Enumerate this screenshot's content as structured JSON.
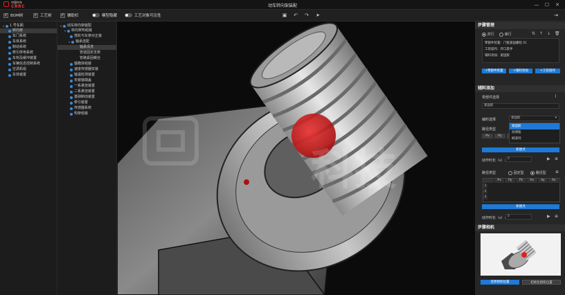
{
  "window": {
    "title": "动车转向架装配",
    "logo_text": "中国中车",
    "logo_brand": "CRRC"
  },
  "toolbar": {
    "bom_tree": "BOM树",
    "process_tree": "工艺树",
    "assist_bar": "辅助栏",
    "model_hide": "模型隐藏",
    "process_visible": "工艺对象可见性"
  },
  "tree_left": [
    {
      "label": "1 号车厢"
    },
    {
      "label": "转向架"
    },
    {
      "label": "车门系统"
    },
    {
      "label": "车体系统"
    },
    {
      "label": "制动系统"
    },
    {
      "label": "牵引供电系统"
    },
    {
      "label": "车钩及缓冲装置"
    },
    {
      "label": "车辆信息控制系统"
    },
    {
      "label": "空调机组"
    },
    {
      "label": "车体装置"
    }
  ],
  "tree_right": [
    {
      "label": "动车转向架装配"
    },
    {
      "label": "转向架构组装"
    },
    {
      "label": "落轮与车架对正装"
    },
    {
      "label": "轴承选配"
    },
    {
      "label": "轴承清洗"
    },
    {
      "label": "管道固定支架"
    },
    {
      "label": "管路紧固螺丝"
    },
    {
      "label": "轴箱体组装"
    },
    {
      "label": "速度传感器安装"
    },
    {
      "label": "轴温检测装置"
    },
    {
      "label": "安装轴端盖"
    },
    {
      "label": "一系悬挂装置"
    },
    {
      "label": "二系悬挂装置"
    },
    {
      "label": "基础制动装置"
    },
    {
      "label": "牵引装置"
    },
    {
      "label": "传感器系统"
    },
    {
      "label": "构架组装"
    }
  ],
  "step_mgmt": {
    "title": "步骤管理",
    "parallel": "并行",
    "serial": "串行",
    "lines": [
      "零部件装置：门框紧固螺栓 01",
      "工装操作：开口扳手",
      "辅料添加：紧固胶"
    ],
    "btn_add_part": "+零部件装置",
    "btn_add_aux": "+辅料添加",
    "btn_add_tool": "+工装操作"
  },
  "aux": {
    "title": "辅料添加",
    "part_select": "零部件选择",
    "part_value": "紧固胶",
    "aux_select": "辅料选择",
    "aux_value": "紧固胶",
    "options": [
      "紧固胶",
      "润滑脂",
      "刷漆剂"
    ],
    "path_type": "路径类型",
    "path_cols": [
      "Px",
      "Py",
      "Pz"
    ],
    "new_point": "新建点",
    "duration_label": "动作时长（s）:",
    "duration_value": "0"
  },
  "path": {
    "path_type": "路径类型",
    "opt1": "固定型",
    "opt2": "路径型",
    "cols": [
      "Px",
      "Py",
      "Pz",
      "Ax",
      "Ay",
      "Az"
    ],
    "rows": [
      "1",
      "2",
      "3"
    ],
    "new_point": "新建点",
    "duration_label": "动作时长（s）:",
    "duration_value": "0"
  },
  "camera": {
    "title": "步骤相机",
    "btn_restore": "还原相机位置",
    "btn_init": "初始化相机位置"
  },
  "viewport": {
    "watermark": "科技"
  },
  "colors": {
    "accent": "#1e7ad6",
    "brand": "#e33333",
    "marker": "#d01f1f"
  }
}
